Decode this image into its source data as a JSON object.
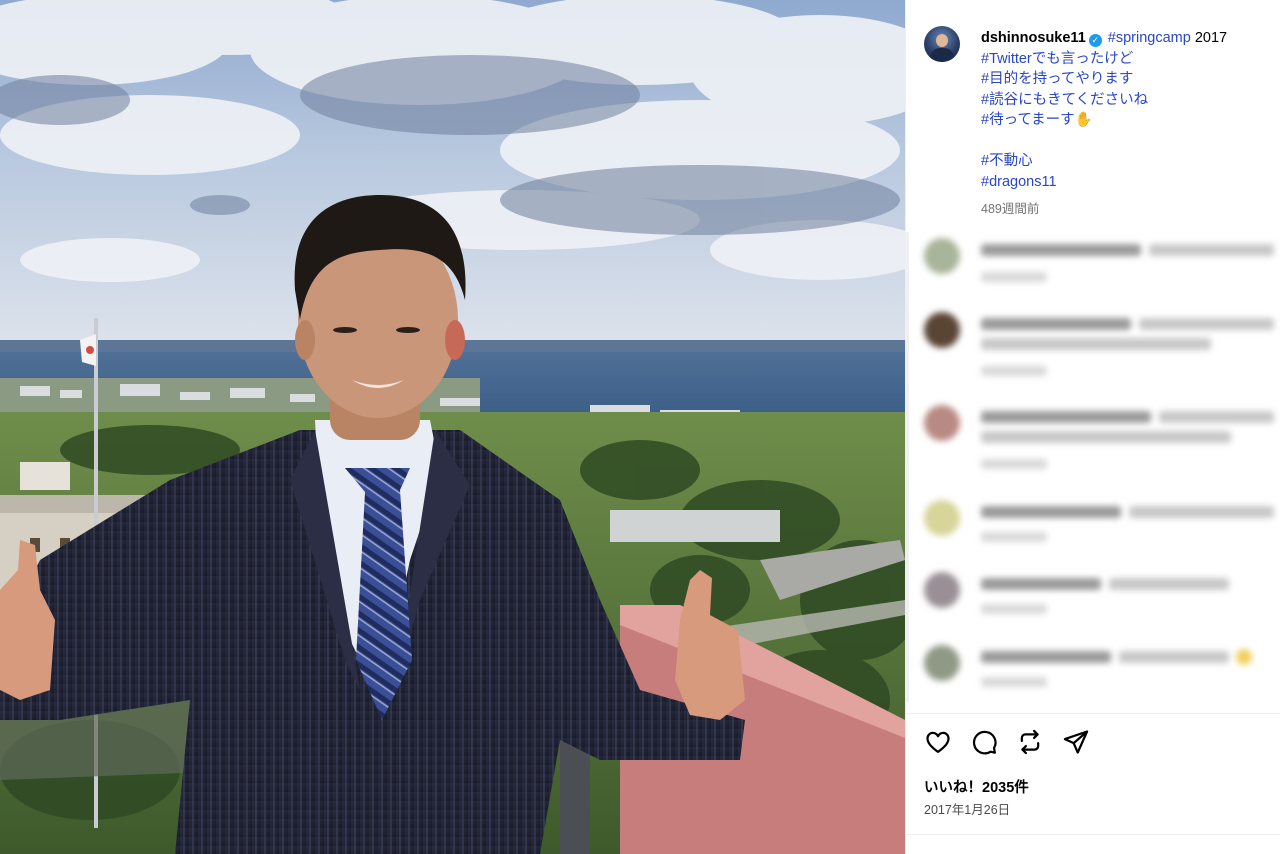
{
  "post": {
    "username": "dshinnosuke11",
    "verified_icon": "verified-badge-icon",
    "caption_first": "#springcamp",
    "caption_first_rest": " 2017",
    "caption_lines": [
      "#Twitterでも言ったけど",
      "#目的を持ってやります",
      "#読谷にもきてくださいね",
      "#待ってまーす✋",
      "",
      "#不動心",
      "#dragons11"
    ],
    "caption_time": "489週間前",
    "likes_text": "いいね！2035件",
    "date_text": "2017年1月26日"
  },
  "actions": {
    "like_icon": "heart-icon",
    "comment_icon": "comment-bubble-icon",
    "repost_icon": "repost-icon",
    "share_icon": "paper-plane-icon"
  },
  "colors": {
    "hashtag": "#2946c7",
    "verified": "#1d9bf0",
    "muted": "#737373"
  }
}
